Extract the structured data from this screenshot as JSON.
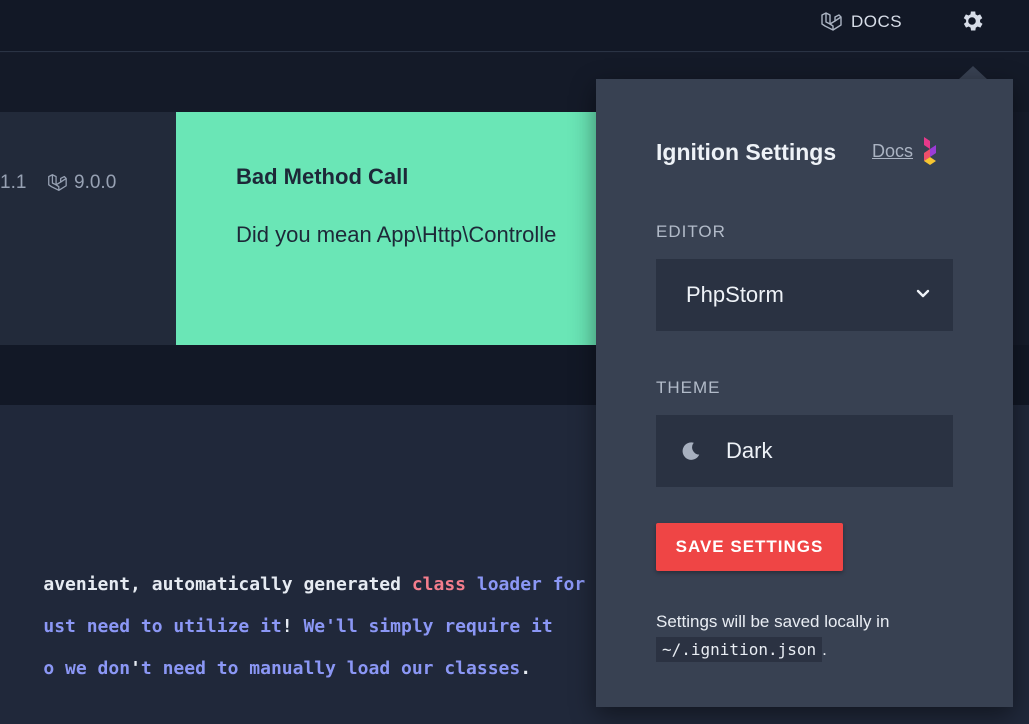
{
  "topbar": {
    "docs_label": "DOCS"
  },
  "header": {
    "php_version": "1.1",
    "laravel_version": "9.0.0"
  },
  "solution": {
    "title": "Bad Method Call",
    "description": "Did you mean App\\Http\\Controlle"
  },
  "code": {
    "lines": [
      [
        {
          "text": "avenient, automatically generated ",
          "color": "white"
        },
        {
          "text": "class",
          "color": "red"
        },
        {
          "text": " ",
          "color": "white"
        },
        {
          "text": "loader for",
          "color": "blue"
        }
      ],
      [
        {
          "text": "ust need to utilize it",
          "color": "blue"
        },
        {
          "text": "! ",
          "color": "white"
        },
        {
          "text": "We'll simply require it",
          "color": "blue"
        }
      ],
      [
        {
          "text": "o we don",
          "color": "blue"
        },
        {
          "text": "'",
          "color": "white"
        },
        {
          "text": "t need to manually load our classes",
          "color": "blue"
        },
        {
          "text": ".",
          "color": "white"
        }
      ]
    ]
  },
  "settings": {
    "title": "Ignition Settings",
    "docs_link": "Docs",
    "editor_label": "EDITOR",
    "editor_value": "PhpStorm",
    "theme_label": "THEME",
    "theme_value": "Dark",
    "save_label": "SAVE SETTINGS",
    "note_text": "Settings will be saved locally in",
    "note_path": "~/.ignition.json",
    "note_suffix": "."
  },
  "colors": {
    "accent_green": "#6ae6b6",
    "save_red": "#ef4545",
    "code_blue": "#8b97f5",
    "code_red": "#f47d8c"
  }
}
